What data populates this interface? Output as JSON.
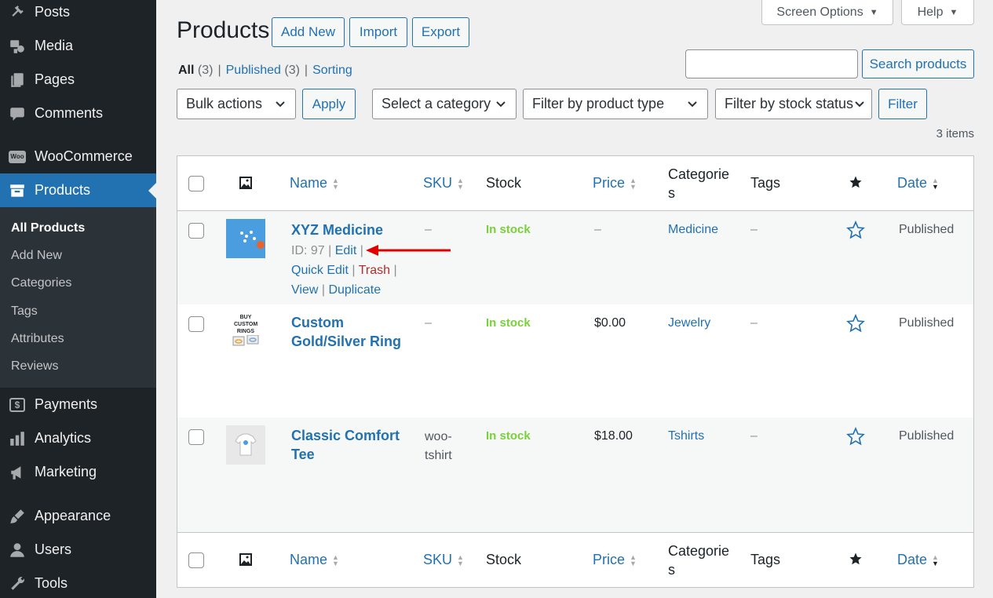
{
  "sidebar": {
    "items": [
      {
        "label": "Posts",
        "icon": "pin-icon"
      },
      {
        "label": "Media",
        "icon": "media-icon"
      },
      {
        "label": "Pages",
        "icon": "pages-icon"
      },
      {
        "label": "Comments",
        "icon": "comments-icon"
      },
      {
        "label": "WooCommerce",
        "icon": "woocommerce-icon",
        "icon_text": "Woo"
      },
      {
        "label": "Products",
        "icon": "products-icon"
      },
      {
        "label": "Payments",
        "icon": "payments-icon",
        "icon_text": "$"
      },
      {
        "label": "Analytics",
        "icon": "analytics-icon"
      },
      {
        "label": "Marketing",
        "icon": "marketing-icon"
      },
      {
        "label": "Appearance",
        "icon": "appearance-icon"
      },
      {
        "label": "Users",
        "icon": "users-icon"
      },
      {
        "label": "Tools",
        "icon": "tools-icon"
      }
    ],
    "submenu": [
      "All Products",
      "Add New",
      "Categories",
      "Tags",
      "Attributes",
      "Reviews"
    ]
  },
  "header": {
    "screen_options": "Screen Options",
    "help": "Help",
    "title": "Products",
    "add_new": "Add New",
    "import": "Import",
    "export": "Export"
  },
  "views": {
    "all": "All",
    "all_count": "(3)",
    "published": "Published",
    "published_count": "(3)",
    "sorting": "Sorting",
    "separator": "|"
  },
  "search": {
    "value": "",
    "button": "Search products"
  },
  "filters": {
    "bulk_actions": "Bulk actions",
    "apply": "Apply",
    "category": "Select a category",
    "product_type": "Filter by product type",
    "stock_status": "Filter by stock status",
    "filter": "Filter",
    "items_count": "3 items"
  },
  "table": {
    "columns": {
      "name": "Name",
      "sku": "SKU",
      "stock": "Stock",
      "price": "Price",
      "categories_line1": "Categorie",
      "categories_line2": "s",
      "tags": "Tags",
      "date": "Date"
    },
    "rows": [
      {
        "name": "XYZ Medicine",
        "sku": "–",
        "stock": "In stock",
        "price": "–",
        "category": "Medicine",
        "tags": "–",
        "date": "Published",
        "row_actions": {
          "id": "ID: 97",
          "edit": "Edit",
          "quick_edit": "Quick Edit",
          "trash": "Trash",
          "view": "View",
          "duplicate": "Duplicate"
        }
      },
      {
        "name_line1": "Custom",
        "name_line2": "Gold/Silver Ring",
        "sku": "–",
        "stock": "In stock",
        "price": "$0.00",
        "category": "Jewelry",
        "tags": "–",
        "date": "Published",
        "thumb_text": "BUY CUSTOM RINGS"
      },
      {
        "name_line1": "Classic Comfort",
        "name_line2": "Tee",
        "sku_line1": "woo-",
        "sku_line2": "tshirt",
        "stock": "In stock",
        "price": "$18.00",
        "category": "Tshirts",
        "tags": "–",
        "date": "Published"
      }
    ]
  },
  "colors": {
    "sidebar_bg": "#1d2327",
    "submenu_bg": "#2c3338",
    "accent": "#2271b1",
    "in_stock": "#7ad03a",
    "trash": "#b32d2e",
    "annotation_arrow": "#e00000"
  }
}
